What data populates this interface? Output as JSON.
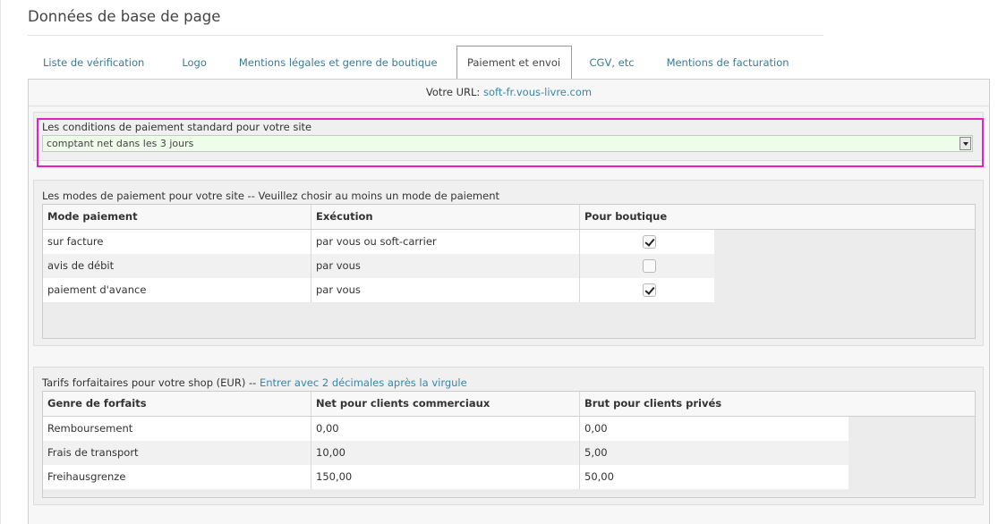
{
  "page": {
    "title": "Données de base de page"
  },
  "tabs": [
    {
      "label": "Liste de vérification",
      "active": false
    },
    {
      "label": "Logo",
      "active": false
    },
    {
      "label": "Mentions légales et genre de boutique",
      "active": false
    },
    {
      "label": "Paiement et envoi",
      "active": true
    },
    {
      "label": "CGV, etc",
      "active": false
    },
    {
      "label": "Mentions de facturation",
      "active": false
    }
  ],
  "url_row": {
    "label": "Votre URL:",
    "url": "soft-fr.vous-livre.com"
  },
  "payment_conditions": {
    "label": "Les conditions de paiement standard pour votre site",
    "selected": "comptant net dans les 3 jours"
  },
  "payment_modes": {
    "label": "Les modes de paiement pour votre site -- Veuillez chosir au moins un mode de paiement",
    "columns": [
      "Mode paiement",
      "Exécution",
      "Pour boutique"
    ],
    "rows": [
      {
        "mode": "sur facture",
        "execution": "par vous ou soft-carrier",
        "checked": true
      },
      {
        "mode": "avis de débit",
        "execution": "par vous",
        "checked": false
      },
      {
        "mode": "paiement d'avance",
        "execution": "par vous",
        "checked": true
      }
    ]
  },
  "flat_rates": {
    "label": "Tarifs forfaitaires pour votre shop (EUR) --",
    "hint": "Entrer avec 2 décimales après la virgule",
    "columns": [
      "Genre de forfaits",
      "Net pour clients commerciaux",
      "Brut pour clients privés"
    ],
    "rows": [
      {
        "type": "Remboursement",
        "net": "0,00",
        "gross": "0,00"
      },
      {
        "type": "Frais de transport",
        "net": "10,00",
        "gross": "5,00"
      },
      {
        "type": "Freihausgrenze",
        "net": "150,00",
        "gross": "50,00"
      }
    ]
  },
  "colors": {
    "accent_link": "#3a86a8",
    "highlight": "#e81fc5",
    "select_bg": "#eefcea"
  }
}
